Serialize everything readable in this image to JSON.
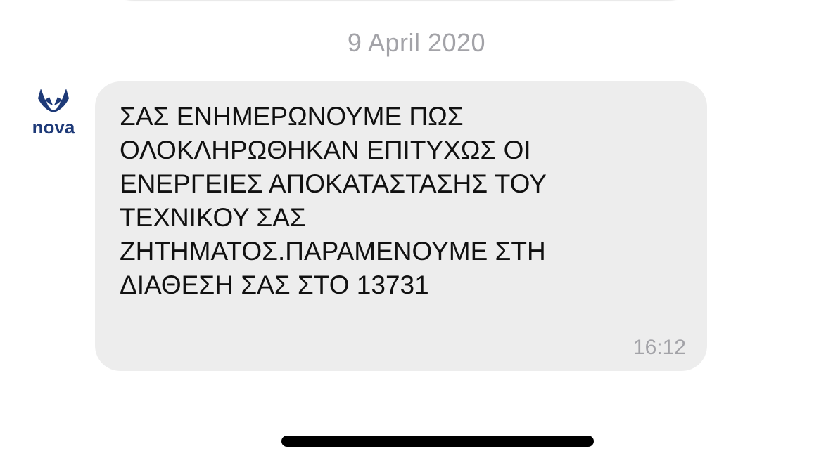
{
  "conversation": {
    "date_header": "9 April 2020",
    "sender": {
      "logo_text": "nova",
      "logo_icon": "nova-sender-logo-icon"
    },
    "message": {
      "text": "ΣΑΣ ΕΝΗΜΕΡΩΝΟΥΜΕ ΠΩΣ\nΟΛΟΚΛΗΡΩΘΗΚΑΝ ΕΠΙΤΥΧΩΣ ΟΙ\nΕΝΕΡΓΕΙΕΣ ΑΠΟΚΑΤΑΣΤΑΣΗΣ ΤΟΥ\nΤΕΧΝΙΚΟΥ ΣΑΣ\nΖΗΤΗΜΑΤΟΣ.ΠΑΡΑΜΕΝΟΥΜΕ ΣΤΗ\nΔΙΑΘΕΣΗ ΣΑΣ ΣΤΟ 13731",
      "time": "16:12"
    }
  },
  "colors": {
    "bubble_background": "#ededed",
    "meta_text": "#a3a3a8",
    "logo_blue": "#1e3a78"
  }
}
